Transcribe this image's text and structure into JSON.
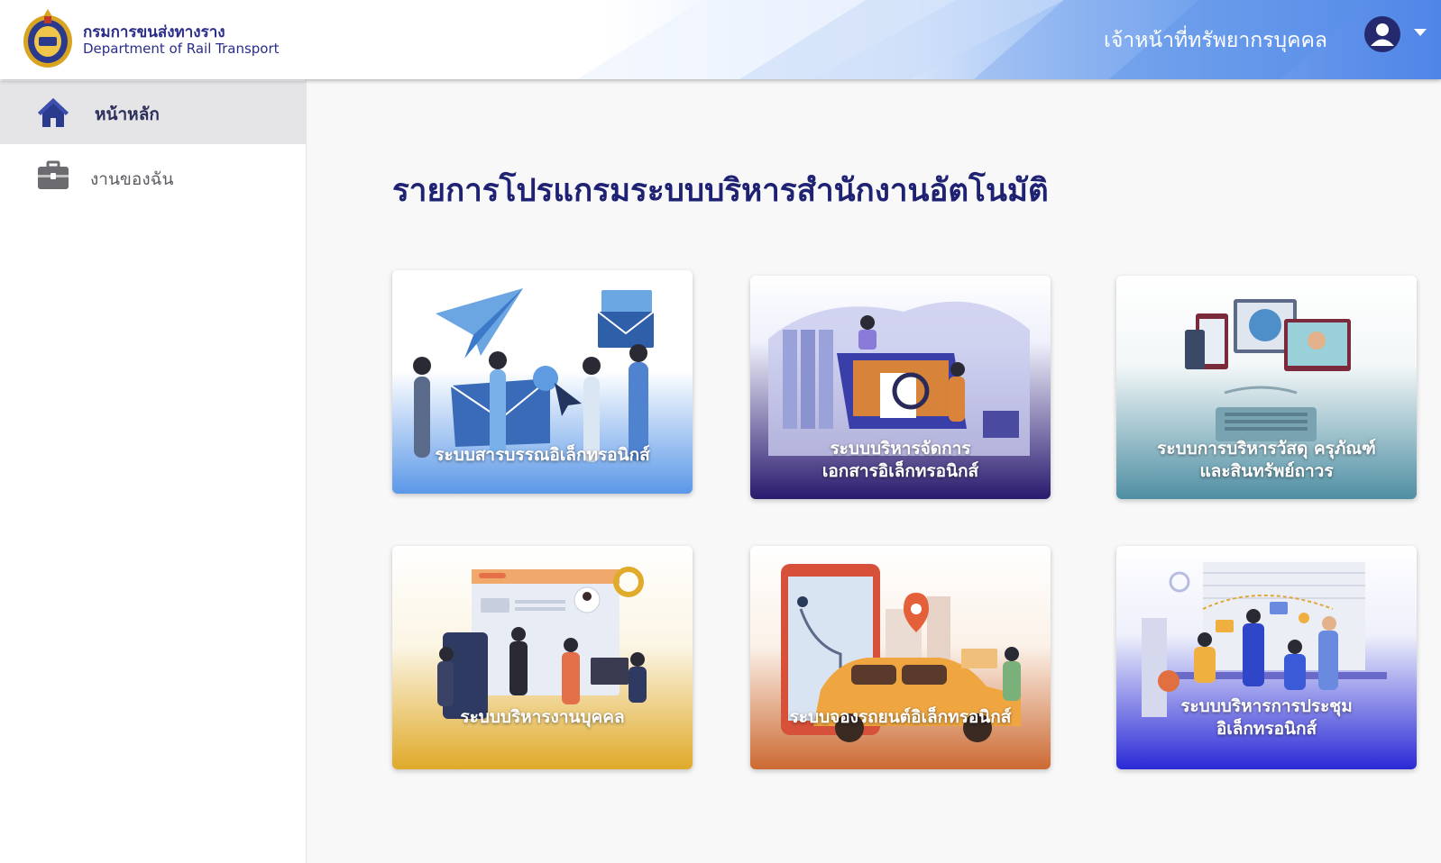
{
  "header": {
    "org_name_th": "กรมการขนส่งทางราง",
    "org_name_en": "Department of Rail Transport",
    "user_role": "เจ้าหน้าที่ทรัพยากรบุคคล",
    "user_icon": "user-icon",
    "menu_icon": "caret-down-icon",
    "accent_color": "#4a86ee"
  },
  "sidebar": {
    "items": [
      {
        "label": "หน้าหลัก",
        "icon": "home-icon",
        "active": true
      },
      {
        "label": "งานของฉัน",
        "icon": "briefcase-icon",
        "active": false
      }
    ]
  },
  "main": {
    "title": "รายการโปรแกรมระบบบริหารสำนักงานอัตโนมัติ",
    "cards": [
      {
        "line1": "ระบบสารบรรณอิเล็กทรอนิกส์",
        "line2": "",
        "color": "#5b98e8"
      },
      {
        "line1": "ระบบบริหารจัดการ",
        "line2": "เอกสารอิเล็กทรอนิกส์",
        "color": "#2a1a6e"
      },
      {
        "line1": "ระบบการบริหารวัสดุ ครุภัณฑ์",
        "line2": "และสินทรัพย์ถาวร",
        "color": "#4f8fa3"
      },
      {
        "line1": "ระบบบริหารงานบุคคล",
        "line2": "",
        "color": "#e0aa2a"
      },
      {
        "line1": "ระบบจองรถยนต์อิเล็กทรอนิกส์",
        "line2": "",
        "color": "#cc6a33"
      },
      {
        "line1": "ระบบบริหารการประชุม",
        "line2": "อิเล็กทรอนิกส์",
        "color": "#2a2ad6"
      }
    ]
  }
}
